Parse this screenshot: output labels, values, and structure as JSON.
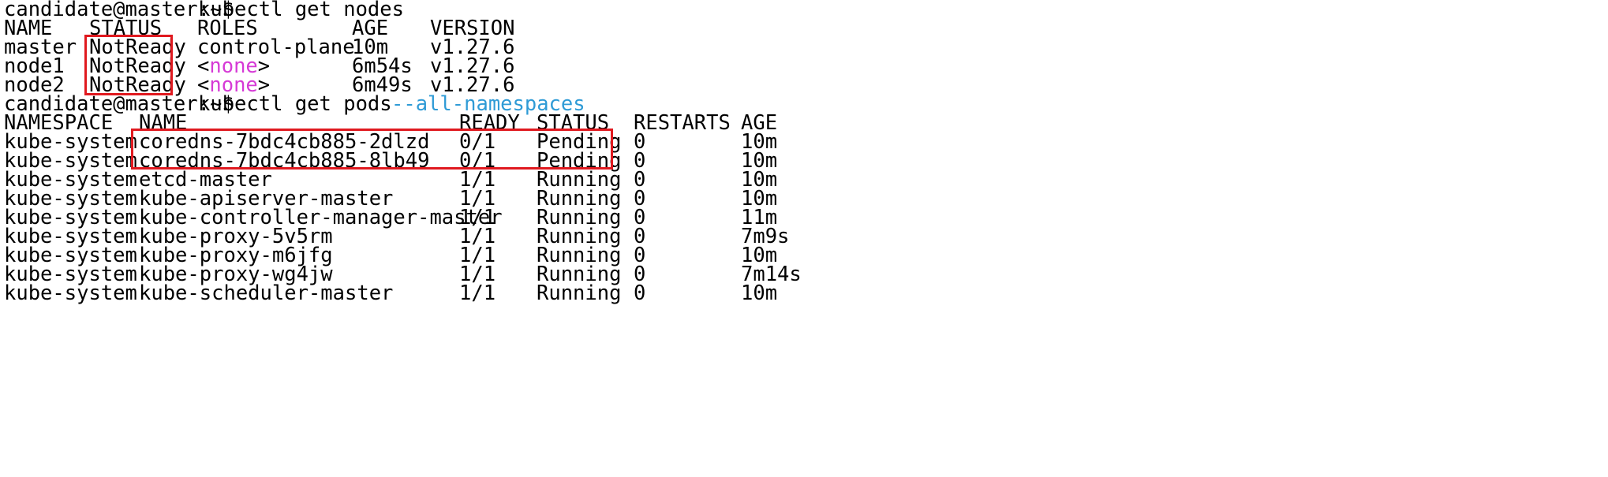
{
  "colors": {
    "highlight": "#e0191f",
    "flag": "#2f9bd6",
    "none_keyword": "#d63ad6"
  },
  "prompt": "candidate@master:~$",
  "command1": "kubectl get nodes",
  "nodes": {
    "headers": [
      "NAME",
      "STATUS",
      "ROLES",
      "AGE",
      "VERSION"
    ],
    "rows": [
      {
        "name": "master",
        "status": "NotReady",
        "roles": "control-plane",
        "age": "10m",
        "version": "v1.27.6"
      },
      {
        "name": "node1",
        "status": "NotReady",
        "roles_open": "<",
        "roles_word": "none",
        "roles_close": ">",
        "age": "6m54s",
        "version": "v1.27.6"
      },
      {
        "name": "node2",
        "status": "NotReady",
        "roles_open": "<",
        "roles_word": "none",
        "roles_close": ">",
        "age": "6m49s",
        "version": "v1.27.6"
      }
    ]
  },
  "command2": "kubectl get pods",
  "command2_flag": "--all-namespaces",
  "pods": {
    "headers": [
      "NAMESPACE",
      "NAME",
      "READY",
      "STATUS",
      "RESTARTS",
      "AGE"
    ],
    "rows": [
      {
        "namespace": "kube-system",
        "name": "coredns-7bdc4cb885-2dlzd",
        "ready": "0/1",
        "status": "Pending",
        "restarts": "0",
        "age": "10m"
      },
      {
        "namespace": "kube-system",
        "name": "coredns-7bdc4cb885-8lb49",
        "ready": "0/1",
        "status": "Pending",
        "restarts": "0",
        "age": "10m"
      },
      {
        "namespace": "kube-system",
        "name": "etcd-master",
        "ready": "1/1",
        "status": "Running",
        "restarts": "0",
        "age": "10m"
      },
      {
        "namespace": "kube-system",
        "name": "kube-apiserver-master",
        "ready": "1/1",
        "status": "Running",
        "restarts": "0",
        "age": "10m"
      },
      {
        "namespace": "kube-system",
        "name": "kube-controller-manager-master",
        "ready": "1/1",
        "status": "Running",
        "restarts": "0",
        "age": "11m"
      },
      {
        "namespace": "kube-system",
        "name": "kube-proxy-5v5rm",
        "ready": "1/1",
        "status": "Running",
        "restarts": "0",
        "age": "7m9s"
      },
      {
        "namespace": "kube-system",
        "name": "kube-proxy-m6jfg",
        "ready": "1/1",
        "status": "Running",
        "restarts": "0",
        "age": "10m"
      },
      {
        "namespace": "kube-system",
        "name": "kube-proxy-wg4jw",
        "ready": "1/1",
        "status": "Running",
        "restarts": "0",
        "age": "7m14s"
      },
      {
        "namespace": "kube-system",
        "name": "kube-scheduler-master",
        "ready": "1/1",
        "status": "Running",
        "restarts": "0",
        "age": "10m"
      }
    ]
  }
}
